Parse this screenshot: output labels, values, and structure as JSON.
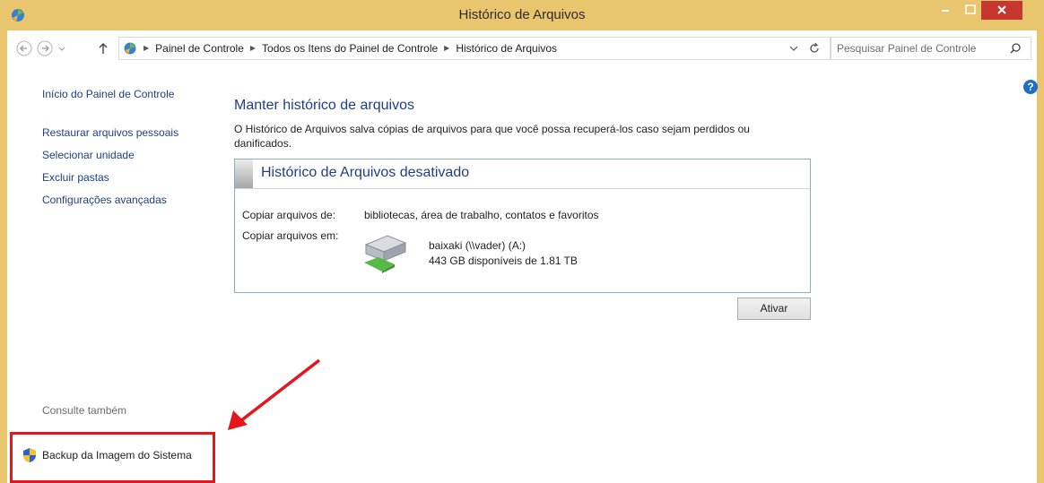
{
  "window": {
    "title": "Histórico de Arquivos",
    "controls": {
      "minimize": "–",
      "maximize": "□",
      "close": "×"
    }
  },
  "address_bar": {
    "breadcrumbs": [
      "Painel de Controle",
      "Todos os Itens do Painel de Controle",
      "Histórico de Arquivos"
    ],
    "search_placeholder": "Pesquisar Painel de Controle"
  },
  "sidebar": {
    "home": "Início do Painel de Controle",
    "links": [
      "Restaurar arquivos pessoais",
      "Selecionar unidade",
      "Excluir pastas",
      "Configurações avançadas"
    ],
    "see_also": "Consulte também",
    "see_also_link": "Backup da Imagem do Sistema"
  },
  "main": {
    "heading": "Manter histórico de arquivos",
    "description": "O Histórico de Arquivos salva cópias de arquivos para que você possa recuperá-los caso sejam perdidos ou danificados.",
    "status_panel": {
      "title": "Histórico de Arquivos desativado",
      "copy_from_label": "Copiar arquivos de:",
      "copy_from_value": "bibliotecas, área de trabalho, contatos e favoritos",
      "copy_to_label": "Copiar arquivos em:",
      "drive_name": "baixaki (\\\\vader) (A:)",
      "drive_space": "443 GB disponíveis de 1.81 TB"
    },
    "activate_button": "Ativar"
  },
  "colors": {
    "title_bar": "#e9c56d",
    "close_button": "#c7372f",
    "link_blue": "#1e3e8a",
    "highlight_red": "#e2161b"
  }
}
